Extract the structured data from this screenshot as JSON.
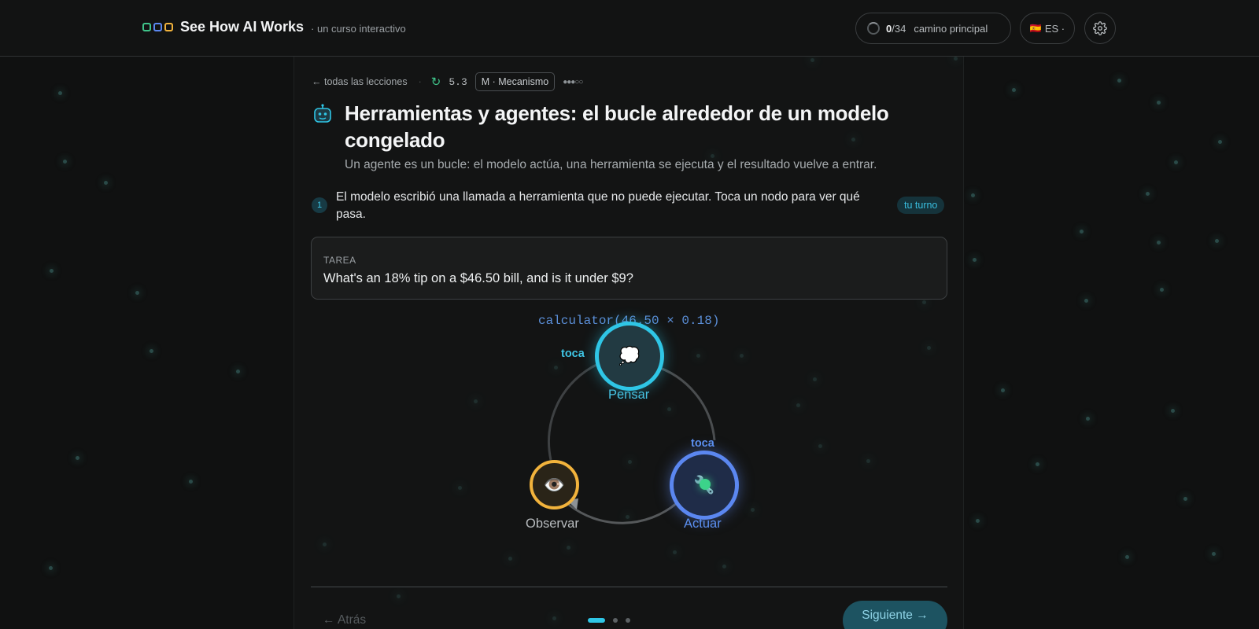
{
  "header": {
    "brand_title": "See How AI Works",
    "brand_sub": "· un curso interactivo",
    "progress_count": "0",
    "progress_total": "/34",
    "progress_label": "camino principal",
    "language": "ES ·",
    "language_flag": "🇪🇸"
  },
  "lesson": {
    "back_link": "← todas las lecciones",
    "number": "5.3",
    "level": "M · Mecanismo",
    "difficulty": "●●●○○",
    "title": "Herramientas y agentes: el bucle alrededor de un modelo congelado",
    "subtitle": "Un agente es un bucle: el modelo actúa, una herramienta se ejecuta y el resultado vuelve a entrar."
  },
  "step": {
    "number": "1",
    "text": "El modelo escribió una llamada a herramienta que no puede ejecutar. Toca un nodo para ver qué pasa.",
    "badge": "tu turno"
  },
  "task": {
    "label": "TAREA",
    "text": "What's an 18% tip on a $46.50 bill, and is it under $9?"
  },
  "diagram": {
    "tool_call": "calculator(46.50 × 0.18)",
    "nodes": {
      "think": {
        "label": "Pensar",
        "icon": "💭",
        "hint": "toca"
      },
      "act": {
        "label": "Actuar",
        "icon": "🔧",
        "hint": "toca"
      },
      "observe": {
        "label": "Observar",
        "icon": "👁️"
      }
    }
  },
  "footer": {
    "back": "← Atrás",
    "next": "Siguiente →",
    "pages": 3,
    "current_page": 1
  },
  "colors": {
    "accent_cyan": "#2fc6e6",
    "accent_blue": "#5b87f0",
    "accent_amber": "#f2b33c",
    "accent_green": "#3cd38a"
  }
}
